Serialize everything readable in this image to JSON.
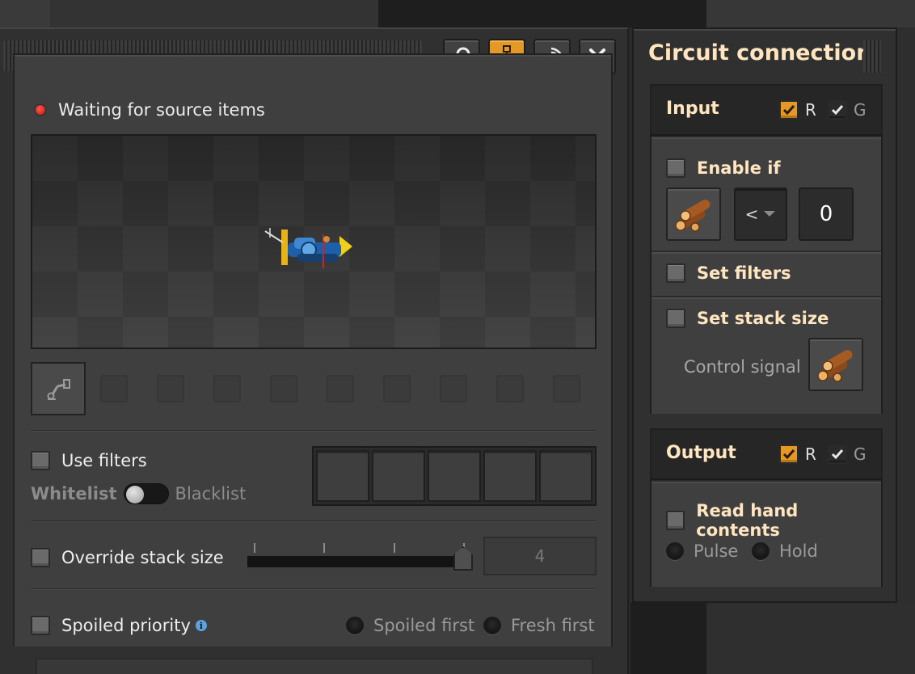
{
  "main_window": {
    "title_buttons": [
      {
        "icon": "magnifier-icon",
        "active": false
      },
      {
        "icon": "network-tree-icon",
        "active": true
      },
      {
        "icon": "circuit-signal-icon",
        "active": false
      },
      {
        "icon": "close-icon",
        "active": false
      }
    ],
    "status": {
      "text": "Waiting for source items",
      "color": "#e0251b"
    },
    "use_filters": {
      "label": "Use filters",
      "checked": false
    },
    "filter_mode": {
      "left": "Whitelist",
      "right": "Blacklist"
    },
    "override_stack": {
      "label": "Override stack size",
      "checked": false,
      "value": "4"
    },
    "spoiled_priority": {
      "label": "Spoiled priority",
      "checked": false,
      "info": "i",
      "options": [
        "Spoiled first",
        "Fresh first"
      ]
    }
  },
  "circuit": {
    "title": "Circuit connection",
    "input": {
      "label": "Input",
      "r_label": "R",
      "g_label": "G",
      "enable_if_label": "Enable if",
      "signal_icon": "wood-icon",
      "comparator": "<",
      "constant": "0",
      "set_filters_label": "Set filters",
      "set_stack_label": "Set stack size",
      "control_signal_label": "Control signal"
    },
    "output": {
      "label": "Output",
      "r_label": "R",
      "g_label": "G",
      "read_hand_label": "Read hand contents",
      "modes": [
        "Pulse",
        "Hold"
      ]
    }
  },
  "colors": {
    "accent": "#e39827",
    "heading": "#ffe6c0"
  }
}
